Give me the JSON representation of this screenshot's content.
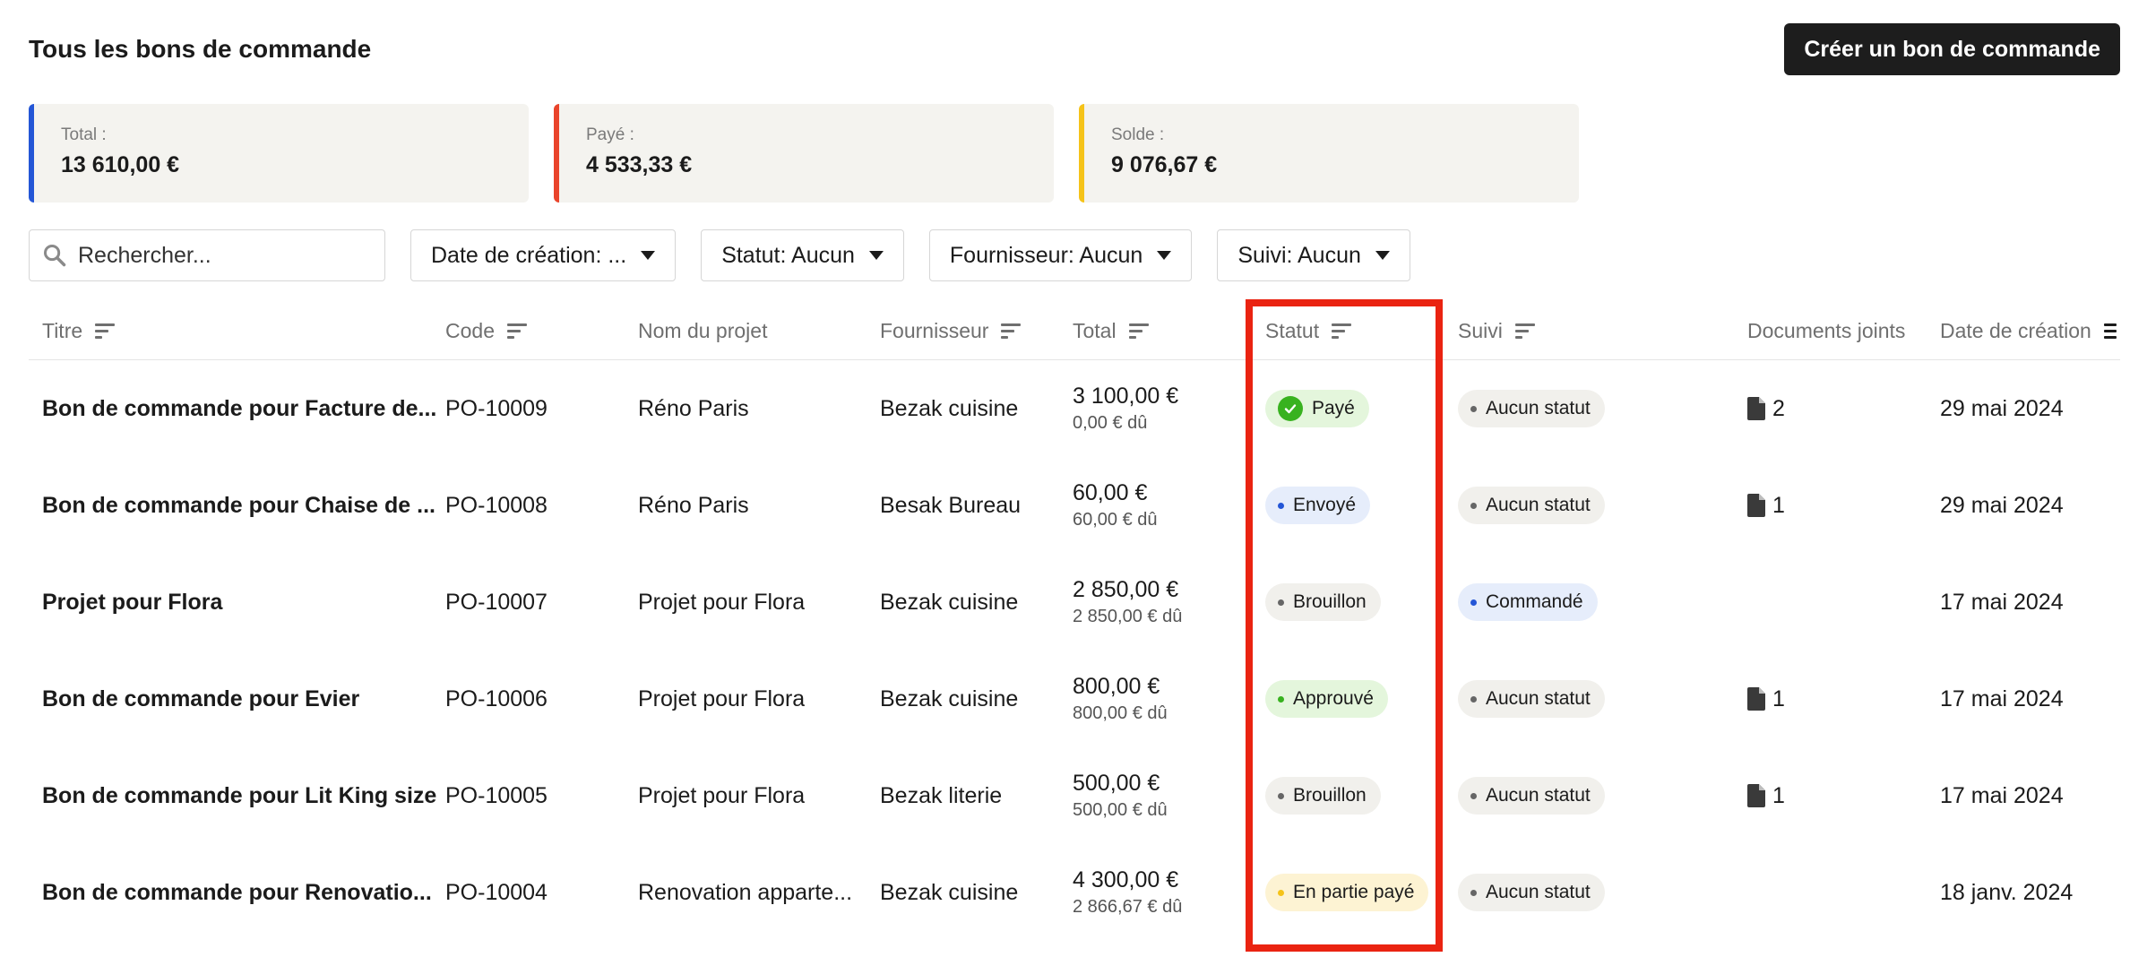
{
  "header": {
    "title": "Tous les bons de commande",
    "create_button": "Créer un bon de commande"
  },
  "summary": [
    {
      "label": "Total :",
      "value": "13 610,00 €",
      "accent": "#2456d6"
    },
    {
      "label": "Payé :",
      "value": "4 533,33 €",
      "accent": "#e9442b"
    },
    {
      "label": "Solde :",
      "value": "9 076,67 €",
      "accent": "#f5c319"
    }
  ],
  "filters": {
    "search_placeholder": "Rechercher...",
    "date": "Date de création: ...",
    "status": "Statut: Aucun",
    "supplier": "Fournisseur: Aucun",
    "tracking": "Suivi: Aucun"
  },
  "columns": {
    "title": "Titre",
    "code": "Code",
    "project": "Nom du projet",
    "supplier": "Fournisseur",
    "total": "Total",
    "status": "Statut",
    "tracking": "Suivi",
    "documents": "Documents joints",
    "created": "Date de création"
  },
  "rows": [
    {
      "title": "Bon de commande pour Facture de...",
      "code": "PO-10009",
      "project": "Réno Paris",
      "supplier": "Bezak cuisine",
      "total": "3 100,00 €",
      "due": "0,00 € dû",
      "status": "Payé",
      "tracking": "Aucun statut",
      "docs": "2",
      "created": "29 mai 2024"
    },
    {
      "title": "Bon de commande pour Chaise de ...",
      "code": "PO-10008",
      "project": "Réno Paris",
      "supplier": "Besak Bureau",
      "total": "60,00 €",
      "due": "60,00 € dû",
      "status": "Envoyé",
      "tracking": "Aucun statut",
      "docs": "1",
      "created": "29 mai 2024"
    },
    {
      "title": "Projet pour Flora",
      "code": "PO-10007",
      "project": "Projet pour Flora",
      "supplier": "Bezak cuisine",
      "total": "2 850,00 €",
      "due": "2 850,00 € dû",
      "status": "Brouillon",
      "tracking": "Commandé",
      "docs": "",
      "created": "17 mai 2024"
    },
    {
      "title": "Bon de commande pour Evier",
      "code": "PO-10006",
      "project": "Projet pour Flora",
      "supplier": "Bezak cuisine",
      "total": "800,00 €",
      "due": "800,00 € dû",
      "status": "Approuvé",
      "tracking": "Aucun statut",
      "docs": "1",
      "created": "17 mai 2024"
    },
    {
      "title": "Bon de commande pour Lit King size",
      "code": "PO-10005",
      "project": "Projet pour Flora",
      "supplier": "Bezak literie",
      "total": "500,00 €",
      "due": "500,00 € dû",
      "status": "Brouillon",
      "tracking": "Aucun statut",
      "docs": "1",
      "created": "17 mai 2024"
    },
    {
      "title": "Bon de commande pour Renovatio...",
      "code": "PO-10004",
      "project": "Renovation apparte...",
      "supplier": "Bezak cuisine",
      "total": "4 300,00 €",
      "due": "2 866,67 € dû",
      "status": "En partie payé",
      "tracking": "Aucun statut",
      "docs": "",
      "created": "18 janv. 2024"
    }
  ]
}
